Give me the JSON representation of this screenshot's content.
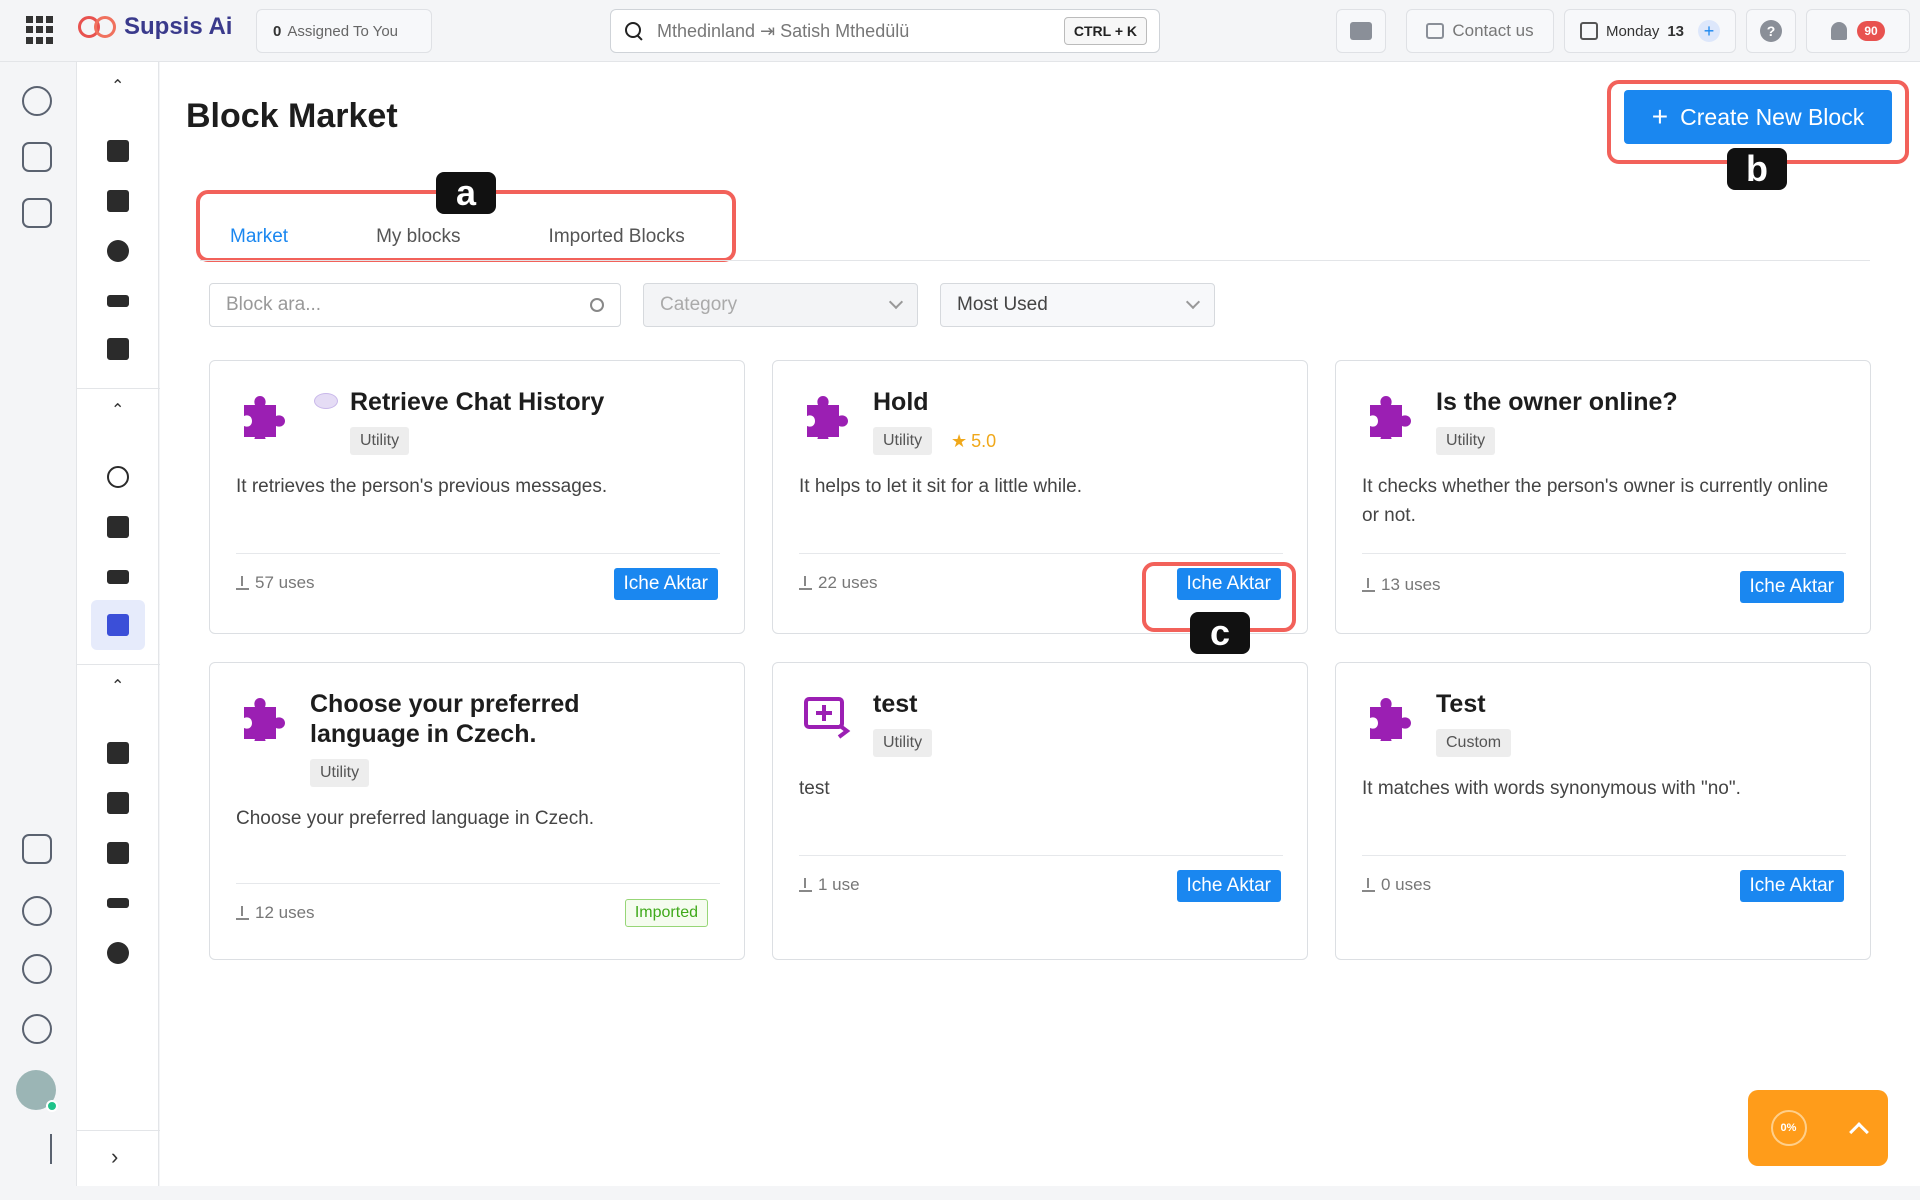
{
  "topbar": {
    "app_name": "Supsis Ai",
    "assigned_count": "0",
    "assigned_label": "Assigned To You",
    "search_text": "Mthedinland ⇥ Satish Mthedülü",
    "search_shortcut": "CTRL + K",
    "contact_label": "Contact us",
    "date_day": "Monday",
    "date_num": "13",
    "notification_count": "90"
  },
  "page": {
    "title": "Block Market",
    "create_button": "Create New Block"
  },
  "tabs": [
    {
      "label": "Market",
      "active": true
    },
    {
      "label": "My blocks",
      "active": false
    },
    {
      "label": "Imported Blocks",
      "active": false
    }
  ],
  "filters": {
    "search_placeholder": "Block ara...",
    "category_placeholder": "Category",
    "sort_value": "Most Used"
  },
  "annotations": {
    "a": "a",
    "b": "b",
    "c": "c"
  },
  "cards": [
    {
      "title": "Retrieve Chat History",
      "tag": "Utility",
      "desc": "It retrieves the person's previous messages.",
      "uses": "57 uses",
      "action": "Iche Aktar"
    },
    {
      "title": "Hold",
      "tag": "Utility",
      "rating": "5.0",
      "desc": "It helps to let it sit for a little while.",
      "uses": "22 uses",
      "action": "Iche Aktar"
    },
    {
      "title": "Is the owner online?",
      "tag": "Utility",
      "desc": "It checks whether the person's owner is currently online or not.",
      "uses": "13 uses",
      "action": "Iche Aktar"
    },
    {
      "title": "Choose your preferred language in Czech.",
      "tag": "Utility",
      "desc": "Choose your preferred language in Czech.",
      "uses": "12 uses",
      "action": "Imported"
    },
    {
      "title": "test",
      "tag": "Utility",
      "desc": "test",
      "uses": "1 use",
      "action": "Iche Aktar"
    },
    {
      "title": "Test",
      "tag": "Custom",
      "desc": "It matches with words synonymous with \"no\".",
      "uses": "0 uses",
      "action": "Iche Aktar"
    }
  ],
  "progress": {
    "percent": "0%"
  },
  "colors": {
    "accent": "#1a87f0",
    "puzzle": "#9b1fb3",
    "highlight": "#f2615a",
    "widget": "#ff9c1a"
  }
}
